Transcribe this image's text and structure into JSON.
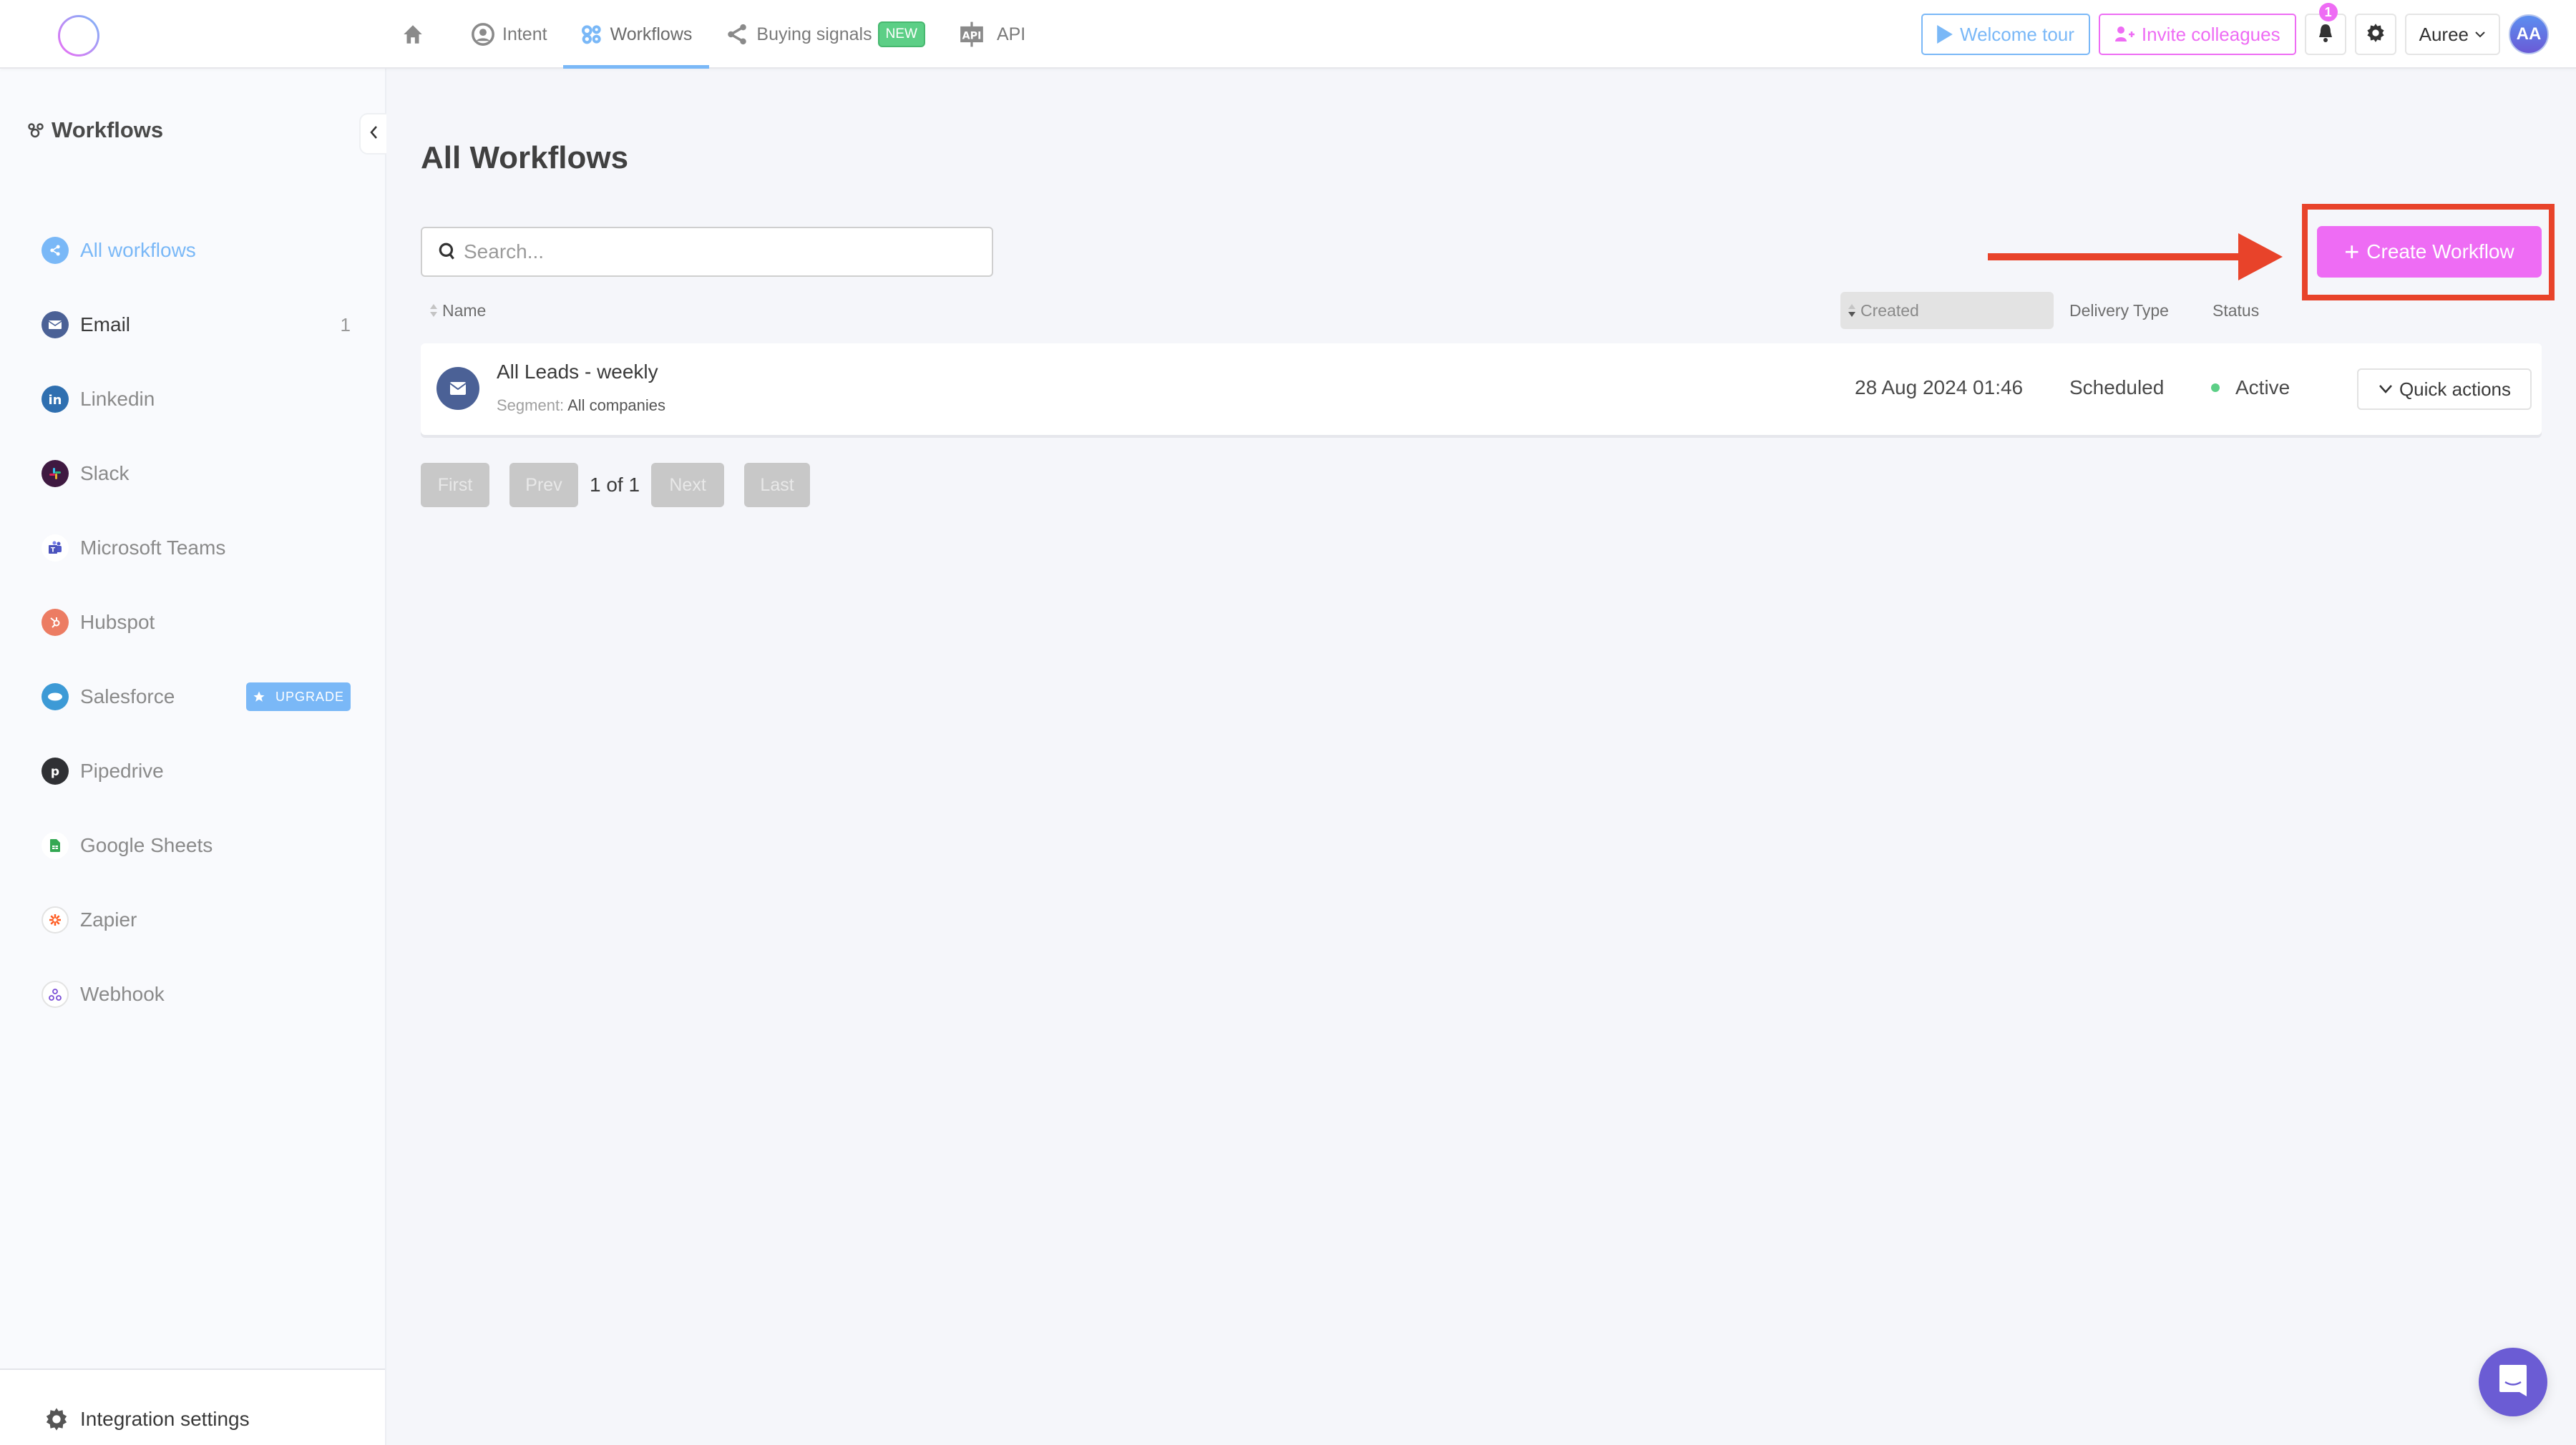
{
  "colors": {
    "accent_blue": "#7ab8f7",
    "accent_pink": "#ee6cf4",
    "new_badge_green": "#5ccf86",
    "annotation_red": "#e8432a",
    "chat_purple": "#6b5cd4",
    "status_active": "#5ccf86"
  },
  "header": {
    "logo_icon": "ring-logo-icon",
    "nav": [
      {
        "id": "home",
        "label": "",
        "icon": "home-icon"
      },
      {
        "id": "intent",
        "label": "Intent",
        "icon": "user-circle-icon"
      },
      {
        "id": "workflows",
        "label": "Workflows",
        "icon": "workflows-icon",
        "active": true
      },
      {
        "id": "buying_signals",
        "label": "Buying signals",
        "icon": "share-icon",
        "badge": "NEW"
      },
      {
        "id": "api",
        "label": "API",
        "icon": "api-icon"
      }
    ],
    "welcome_tour_label": "Welcome tour",
    "invite_label": "Invite colleagues",
    "notification_count": "1",
    "user_name": "Auree",
    "avatar_initials": "AA"
  },
  "sidebar": {
    "title": "Workflows",
    "items": [
      {
        "label": "All workflows",
        "icon": "share-icon",
        "active": true
      },
      {
        "label": "Email",
        "icon": "email-icon",
        "count": "1"
      },
      {
        "label": "Linkedin",
        "icon": "linkedin-icon"
      },
      {
        "label": "Slack",
        "icon": "slack-icon"
      },
      {
        "label": "Microsoft Teams",
        "icon": "teams-icon"
      },
      {
        "label": "Hubspot",
        "icon": "hubspot-icon"
      },
      {
        "label": "Salesforce",
        "icon": "salesforce-icon",
        "badge": "UPGRADE"
      },
      {
        "label": "Pipedrive",
        "icon": "pipedrive-icon"
      },
      {
        "label": "Google Sheets",
        "icon": "google-sheets-icon"
      },
      {
        "label": "Zapier",
        "icon": "zapier-icon"
      },
      {
        "label": "Webhook",
        "icon": "webhook-icon"
      }
    ],
    "settings_label": "Integration settings"
  },
  "main": {
    "title": "All Workflows",
    "search": {
      "placeholder": "Search...",
      "value": ""
    },
    "create_button_label": "Create Workflow",
    "columns": {
      "name": "Name",
      "created": "Created",
      "delivery_type": "Delivery Type",
      "status": "Status"
    },
    "rows": [
      {
        "name": "All Leads - weekly",
        "segment_label": "Segment:",
        "segment_value": "All companies",
        "created": "28 Aug 2024 01:46",
        "delivery_type": "Scheduled",
        "status": "Active",
        "action_label": "Quick actions"
      }
    ],
    "pagination": {
      "first": "First",
      "prev": "Prev",
      "info": "1 of 1",
      "next": "Next",
      "last": "Last"
    }
  }
}
